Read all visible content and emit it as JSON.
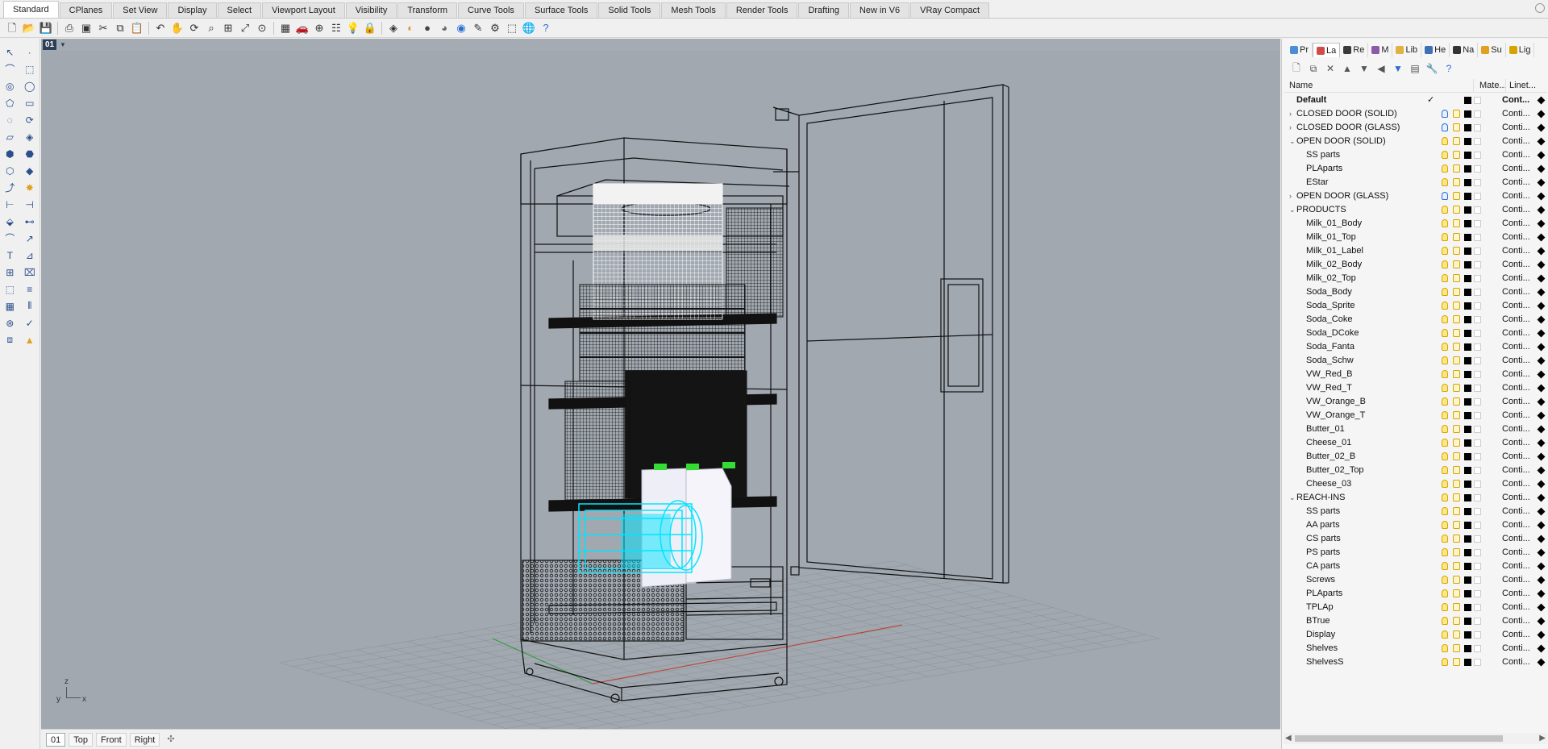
{
  "tabs": [
    "Standard",
    "CPlanes",
    "Set View",
    "Display",
    "Select",
    "Viewport Layout",
    "Visibility",
    "Transform",
    "Curve Tools",
    "Surface Tools",
    "Solid Tools",
    "Mesh Tools",
    "Render Tools",
    "Drafting",
    "New in V6",
    "VRay Compact"
  ],
  "active_tab": "Standard",
  "toolbar_icons": [
    "new-file-icon",
    "open-icon",
    "save-icon",
    "print-icon",
    "save-small-icon",
    "cut-icon",
    "copy-icon",
    "paste-icon",
    "undo-icon",
    "pan-icon",
    "rotate-view-icon",
    "zoom-icon",
    "zoom-window-icon",
    "zoom-extents-icon",
    "zoom-selected-icon",
    "grid-icon",
    "car-icon",
    "object-snap-icon",
    "properties-icon",
    "light-bulb-icon",
    "lock-icon",
    "layer-icon",
    "color-wheel-icon",
    "render-sphere-icon",
    "render-preview-icon",
    "material-sphere-icon",
    "pen-icon",
    "gear-icon",
    "select-icon",
    "globe-icon",
    "help-icon"
  ],
  "viewport": {
    "name": "01",
    "axis_labels": {
      "z": "z",
      "y": "y",
      "x": "x"
    }
  },
  "viewport_tabs": [
    "01",
    "Top",
    "Front",
    "Right"
  ],
  "viewport_add": "✣",
  "panel": {
    "tabs": [
      {
        "label": "Pr",
        "color": "#4a8fd6"
      },
      {
        "label": "La",
        "color": "#d24b4b"
      },
      {
        "label": "Re",
        "color": "#3a3a3a"
      },
      {
        "label": "M",
        "color": "#8b5aa8"
      },
      {
        "label": "Lib",
        "color": "#e0b341"
      },
      {
        "label": "He",
        "color": "#3f6fb5"
      },
      {
        "label": "Na",
        "color": "#333333"
      },
      {
        "label": "Su",
        "color": "#e0a020"
      },
      {
        "label": "Lig",
        "color": "#d6a400"
      }
    ],
    "active_tab": "La",
    "columns": {
      "name": "Name",
      "material": "Mate...",
      "linetype": "Linet..."
    },
    "layers": [
      {
        "name": "Default",
        "level": 0,
        "bold": true,
        "current": true,
        "linetype": "Cont...",
        "expand": ""
      },
      {
        "name": "CLOSED DOOR (SOLID)",
        "level": 0,
        "linetype": "Conti...",
        "expand": "›",
        "off": true
      },
      {
        "name": "CLOSED DOOR (GLASS)",
        "level": 0,
        "linetype": "Conti...",
        "expand": "›",
        "off": true
      },
      {
        "name": "OPEN DOOR (SOLID)",
        "level": 0,
        "linetype": "Conti...",
        "expand": "⌄"
      },
      {
        "name": "SS parts",
        "level": 1,
        "linetype": "Conti...",
        "expand": ""
      },
      {
        "name": "PLAparts",
        "level": 1,
        "linetype": "Conti...",
        "expand": ""
      },
      {
        "name": "EStar",
        "level": 1,
        "linetype": "Conti...",
        "expand": ""
      },
      {
        "name": "OPEN DOOR (GLASS)",
        "level": 0,
        "linetype": "Conti...",
        "expand": "›",
        "off": true
      },
      {
        "name": "PRODUCTS",
        "level": 0,
        "linetype": "Conti...",
        "expand": "⌄"
      },
      {
        "name": "Milk_01_Body",
        "level": 1,
        "linetype": "Conti...",
        "expand": ""
      },
      {
        "name": "Milk_01_Top",
        "level": 1,
        "linetype": "Conti...",
        "expand": ""
      },
      {
        "name": "Milk_01_Label",
        "level": 1,
        "linetype": "Conti...",
        "expand": ""
      },
      {
        "name": "Milk_02_Body",
        "level": 1,
        "linetype": "Conti...",
        "expand": ""
      },
      {
        "name": "Milk_02_Top",
        "level": 1,
        "linetype": "Conti...",
        "expand": ""
      },
      {
        "name": "Soda_Body",
        "level": 1,
        "linetype": "Conti...",
        "expand": ""
      },
      {
        "name": "Soda_Sprite",
        "level": 1,
        "linetype": "Conti...",
        "expand": ""
      },
      {
        "name": "Soda_Coke",
        "level": 1,
        "linetype": "Conti...",
        "expand": ""
      },
      {
        "name": "Soda_DCoke",
        "level": 1,
        "linetype": "Conti...",
        "expand": ""
      },
      {
        "name": "Soda_Fanta",
        "level": 1,
        "linetype": "Conti...",
        "expand": ""
      },
      {
        "name": "Soda_Schw",
        "level": 1,
        "linetype": "Conti...",
        "expand": ""
      },
      {
        "name": "VW_Red_B",
        "level": 1,
        "linetype": "Conti...",
        "expand": ""
      },
      {
        "name": "VW_Red_T",
        "level": 1,
        "linetype": "Conti...",
        "expand": ""
      },
      {
        "name": "VW_Orange_B",
        "level": 1,
        "linetype": "Conti...",
        "expand": ""
      },
      {
        "name": "VW_Orange_T",
        "level": 1,
        "linetype": "Conti...",
        "expand": ""
      },
      {
        "name": "Butter_01",
        "level": 1,
        "linetype": "Conti...",
        "expand": ""
      },
      {
        "name": "Cheese_01",
        "level": 1,
        "linetype": "Conti...",
        "expand": ""
      },
      {
        "name": "Butter_02_B",
        "level": 1,
        "linetype": "Conti...",
        "expand": ""
      },
      {
        "name": "Butter_02_Top",
        "level": 1,
        "linetype": "Conti...",
        "expand": ""
      },
      {
        "name": "Cheese_03",
        "level": 1,
        "linetype": "Conti...",
        "expand": ""
      },
      {
        "name": "REACH-INS",
        "level": 0,
        "linetype": "Conti...",
        "expand": "⌄"
      },
      {
        "name": "SS parts",
        "level": 1,
        "linetype": "Conti...",
        "expand": ""
      },
      {
        "name": "AA parts",
        "level": 1,
        "linetype": "Conti...",
        "expand": ""
      },
      {
        "name": "CS parts",
        "level": 1,
        "linetype": "Conti...",
        "expand": ""
      },
      {
        "name": "PS parts",
        "level": 1,
        "linetype": "Conti...",
        "expand": ""
      },
      {
        "name": "CA parts",
        "level": 1,
        "linetype": "Conti...",
        "expand": ""
      },
      {
        "name": "Screws",
        "level": 1,
        "linetype": "Conti...",
        "expand": ""
      },
      {
        "name": "PLAparts",
        "level": 1,
        "linetype": "Conti...",
        "expand": ""
      },
      {
        "name": "TPLAp",
        "level": 1,
        "linetype": "Conti...",
        "expand": ""
      },
      {
        "name": "BTrue",
        "level": 1,
        "linetype": "Conti...",
        "expand": ""
      },
      {
        "name": "Display",
        "level": 1,
        "linetype": "Conti...",
        "expand": ""
      },
      {
        "name": "Shelves",
        "level": 1,
        "linetype": "Conti...",
        "expand": ""
      },
      {
        "name": "ShelvesS",
        "level": 1,
        "linetype": "Conti...",
        "expand": ""
      }
    ]
  },
  "colors": {
    "viewport_bg": "#a1a8b0",
    "wire": "#111111",
    "cyan_highlight": "#00e5ff",
    "green_caps": "#33dd33",
    "axis_red": "#c0392b",
    "axis_green": "#2e9b3c"
  }
}
